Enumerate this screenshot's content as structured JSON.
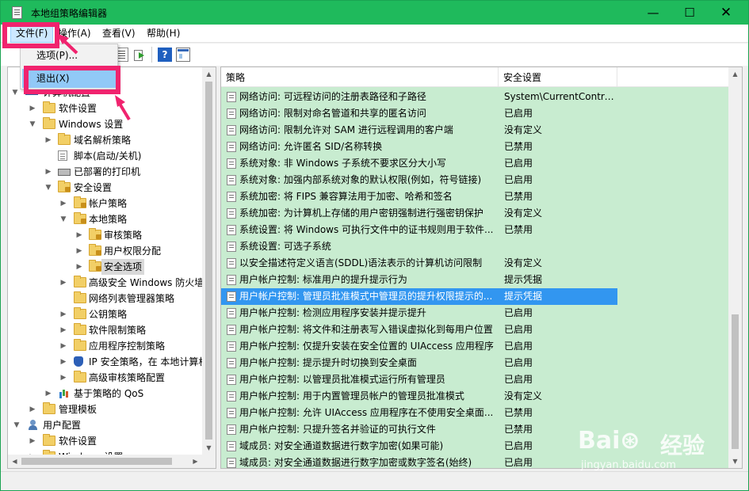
{
  "window": {
    "title": "本地组策略编辑器",
    "minimize": "—",
    "maximize": "☐",
    "close": "✕"
  },
  "menubar": {
    "file": "文件(F)",
    "action": "操作(A)",
    "view": "查看(V)",
    "help": "帮助(H)"
  },
  "file_menu": {
    "options": "选项(P)...",
    "exit": "退出(X)"
  },
  "toolbar": {
    "help_glyph": "?"
  },
  "tree": {
    "computer_config": "计算机配置",
    "software_settings": "软件设置",
    "windows_settings": "Windows 设置",
    "dns_policy": "域名解析策略",
    "scripts": "脚本(启动/关机)",
    "printers": "已部署的打印机",
    "security_settings": "安全设置",
    "account_policy": "帐户策略",
    "local_policy": "本地策略",
    "audit_policy": "审核策略",
    "user_rights": "用户权限分配",
    "security_options": "安全选项",
    "firewall": "高级安全 Windows 防火墙",
    "network_list": "网络列表管理器策略",
    "public_key": "公钥策略",
    "software_restriction": "软件限制策略",
    "app_control": "应用程序控制策略",
    "ipsec": "IP 安全策略，在 本地计算机",
    "advanced_audit": "高级审核策略配置",
    "qos": "基于策略的 QoS",
    "admin_templates": "管理模板",
    "user_config": "用户配置",
    "user_software": "软件设置",
    "user_windows": "Windows 设置"
  },
  "list": {
    "col_policy": "策略",
    "col_setting": "安全设置",
    "rows": [
      {
        "name": "网络访问: 可远程访问的注册表路径和子路径",
        "value": "System\\CurrentContro..."
      },
      {
        "name": "网络访问: 限制对命名管道和共享的匿名访问",
        "value": "已启用"
      },
      {
        "name": "网络访问: 限制允许对 SAM 进行远程调用的客户端",
        "value": "没有定义"
      },
      {
        "name": "网络访问: 允许匿名 SID/名称转换",
        "value": "已禁用"
      },
      {
        "name": "系统对象: 非 Windows 子系统不要求区分大小写",
        "value": "已启用"
      },
      {
        "name": "系统对象: 加强内部系统对象的默认权限(例如，符号链接)",
        "value": "已启用"
      },
      {
        "name": "系统加密: 将 FIPS 兼容算法用于加密、哈希和签名",
        "value": "已禁用"
      },
      {
        "name": "系统加密: 为计算机上存储的用户密钥强制进行强密钥保护",
        "value": "没有定义"
      },
      {
        "name": "系统设置: 将 Windows 可执行文件中的证书规则用于软件...",
        "value": "已禁用"
      },
      {
        "name": "系统设置: 可选子系统",
        "value": ""
      },
      {
        "name": "以安全描述符定义语言(SDDL)语法表示的计算机访问限制",
        "value": "没有定义"
      },
      {
        "name": "用户帐户控制: 标准用户的提升提示行为",
        "value": "提示凭据"
      },
      {
        "name": "用户帐户控制: 管理员批准模式中管理员的提升权限提示的...",
        "value": "提示凭据"
      },
      {
        "name": "用户帐户控制: 检测应用程序安装并提示提升",
        "value": "已启用"
      },
      {
        "name": "用户帐户控制: 将文件和注册表写入错误虚拟化到每用户位置",
        "value": "已启用"
      },
      {
        "name": "用户帐户控制: 仅提升安装在安全位置的 UIAccess 应用程序",
        "value": "已启用"
      },
      {
        "name": "用户帐户控制: 提示提升时切换到安全桌面",
        "value": "已启用"
      },
      {
        "name": "用户帐户控制: 以管理员批准模式运行所有管理员",
        "value": "已启用"
      },
      {
        "name": "用户帐户控制: 用于内置管理员帐户的管理员批准模式",
        "value": "没有定义"
      },
      {
        "name": "用户帐户控制: 允许 UIAccess 应用程序在不使用安全桌面...",
        "value": "已禁用"
      },
      {
        "name": "用户帐户控制: 只提升签名并验证的可执行文件",
        "value": "已禁用"
      },
      {
        "name": "域成员: 对安全通道数据进行数字加密(如果可能)",
        "value": "已启用"
      },
      {
        "name": "域成员: 对安全通道数据进行数字加密或数字签名(始终)",
        "value": "已启用"
      }
    ]
  },
  "watermark": {
    "logo": "Bai⊛",
    "text": "经验",
    "url": "jingyan.baidu.com"
  },
  "colors": {
    "titlebar": "#1fba5c",
    "list_bg": "#c8ecd0",
    "selection": "#3296f0",
    "annotation": "#f0236e"
  }
}
